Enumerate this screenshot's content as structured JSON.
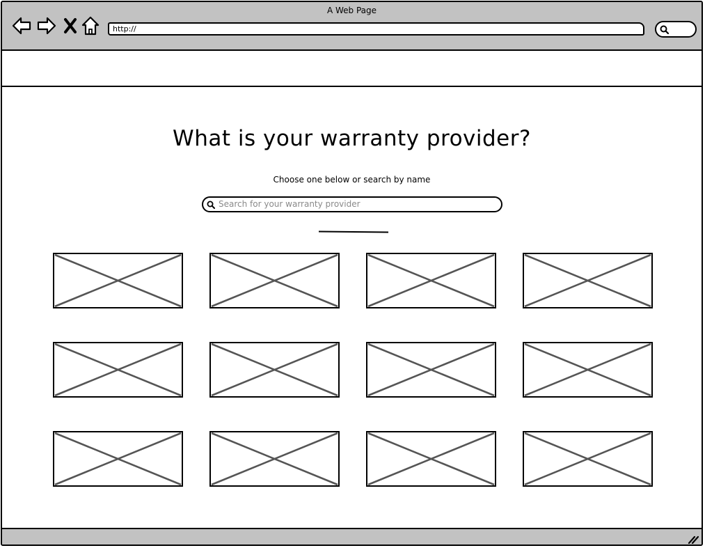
{
  "window": {
    "title": "A Web Page"
  },
  "browser": {
    "url": "http://",
    "nav_icons": [
      "back-arrow-icon",
      "forward-arrow-icon",
      "close-icon",
      "home-icon"
    ],
    "search_icon": "search-icon"
  },
  "main": {
    "title": "What is your warranty provider?",
    "subtitle": "Choose one below or search by name",
    "search": {
      "placeholder": "Search for your warranty provider",
      "icon": "search-icon"
    },
    "providers": [
      {
        "image": "image-placeholder"
      },
      {
        "image": "image-placeholder"
      },
      {
        "image": "image-placeholder"
      },
      {
        "image": "image-placeholder"
      },
      {
        "image": "image-placeholder"
      },
      {
        "image": "image-placeholder"
      },
      {
        "image": "image-placeholder"
      },
      {
        "image": "image-placeholder"
      },
      {
        "image": "image-placeholder"
      },
      {
        "image": "image-placeholder"
      },
      {
        "image": "image-placeholder"
      },
      {
        "image": "image-placeholder"
      }
    ]
  },
  "colors": {
    "chrome": "#c2c2c2",
    "placeholder_text": "#8a8a8a",
    "placeholder_cross": "#555555"
  }
}
